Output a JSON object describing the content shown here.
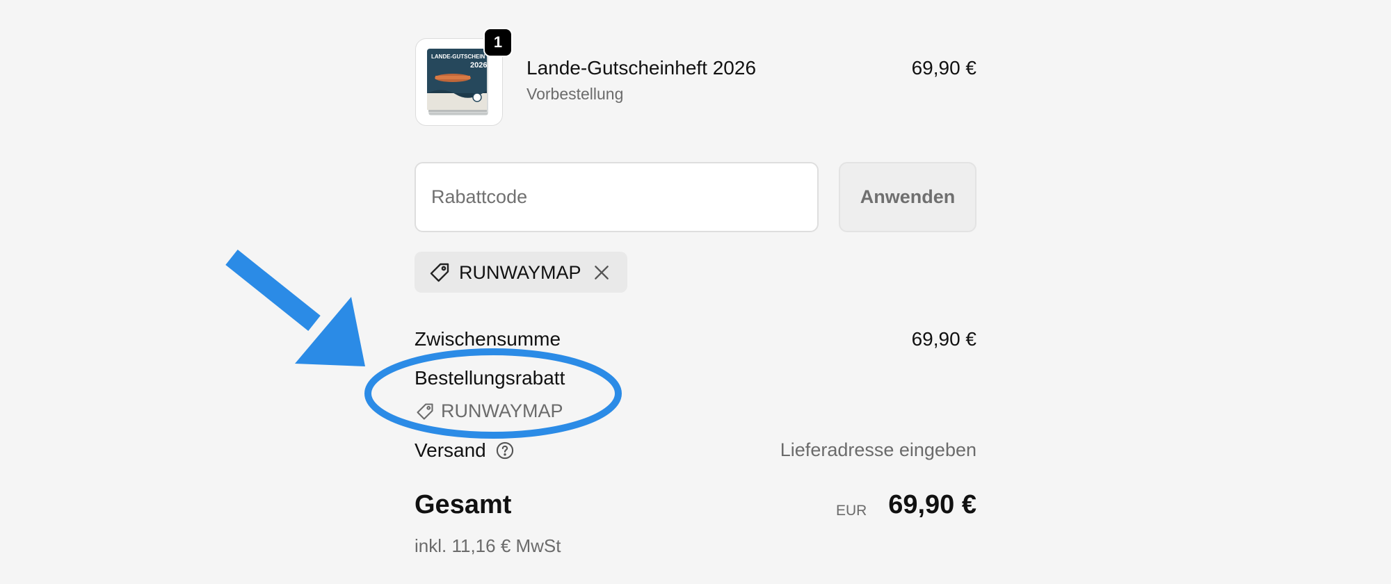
{
  "cart_item": {
    "quantity": "1",
    "name": "Lande-Gutscheinheft 2026",
    "subtitle": "Vorbestellung",
    "price": "69,90 €",
    "thumbnail_text": "LANDE-GUTSCHEIN",
    "thumbnail_year": "2026"
  },
  "discount": {
    "placeholder": "Rabattcode",
    "apply_label": "Anwenden",
    "applied_code": "RUNWAYMAP"
  },
  "summary": {
    "subtotal_label": "Zwischensumme",
    "subtotal_value": "69,90 €",
    "order_discount_label": "Bestellungsrabatt",
    "order_discount_code": "RUNWAYMAP",
    "shipping_label": "Versand",
    "shipping_value": "Lieferadresse eingeben",
    "total_label": "Gesamt",
    "total_currency": "EUR",
    "total_value": "69,90 €",
    "tax_note": "inkl. 11,16 € MwSt"
  },
  "colors": {
    "background": "#f5f5f5",
    "annotation_blue": "#2b8be6",
    "badge": "#000000",
    "muted_text": "#6b6b6b"
  },
  "icons": [
    "tag-icon",
    "close-icon",
    "help-circle-icon",
    "arrow-annotation",
    "ellipse-annotation"
  ]
}
